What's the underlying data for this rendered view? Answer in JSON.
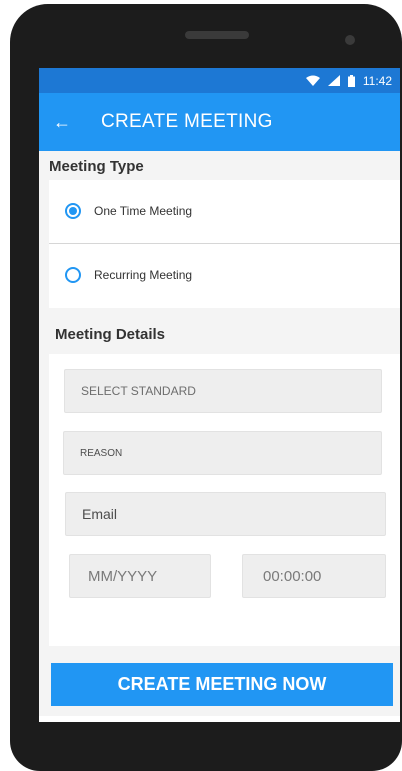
{
  "status_bar": {
    "time": "11:42",
    "icons": [
      "wifi-icon",
      "signal-icon",
      "battery-icon"
    ]
  },
  "app_bar": {
    "back_icon": "arrow-left-icon",
    "title": "CREATE MEETING"
  },
  "meeting_type": {
    "title": "Meeting Type",
    "options": [
      {
        "label": "One Time Meeting",
        "selected": true
      },
      {
        "label": "Recurring Meeting",
        "selected": false
      }
    ]
  },
  "meeting_details": {
    "title": "Meeting Details",
    "select_standard": "SELECT STANDARD",
    "reason": "REASON",
    "email": "Email",
    "date": "MM/YYYY",
    "time": "00:00:00"
  },
  "cta": {
    "label": "CREATE MEETING NOW"
  },
  "colors": {
    "primary": "#2196f3",
    "status_bar": "#1d78d4",
    "background": "#f4f4f4"
  }
}
